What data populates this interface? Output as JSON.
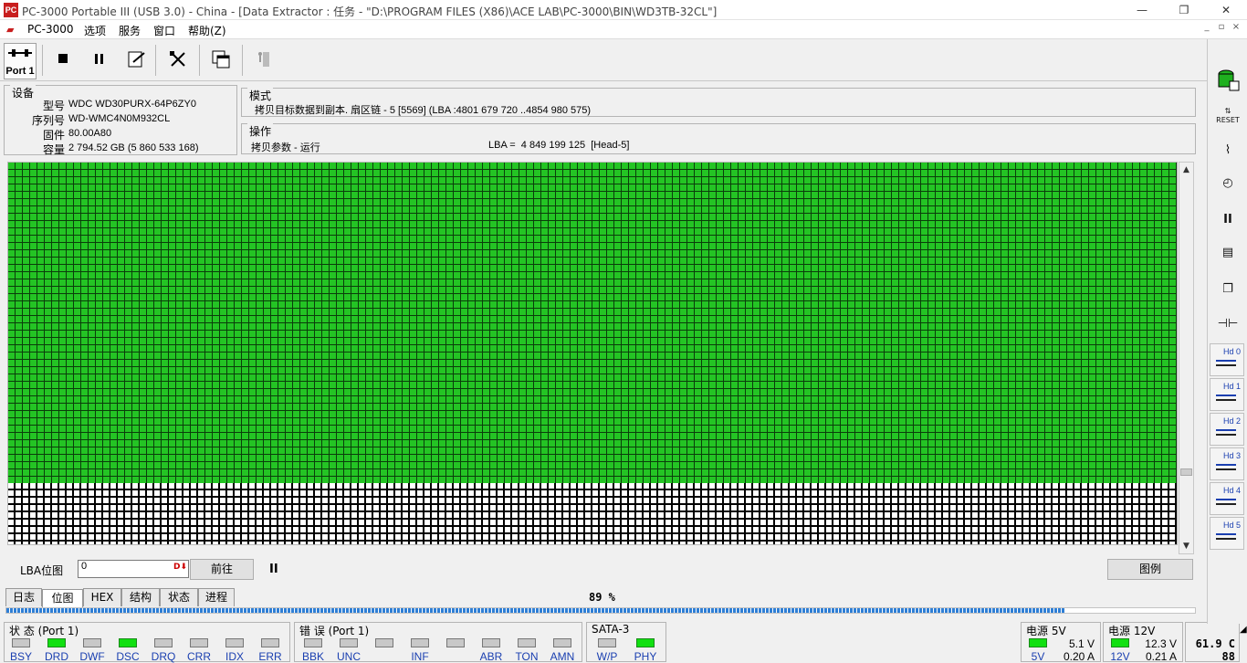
{
  "window": {
    "title": "PC-3000 Portable III (USB 3.0) - China - [Data Extractor : 任务 - \"D:\\PROGRAM FILES (X86)\\ACE LAB\\PC-3000\\BIN\\WD3TB-32CL\"]",
    "app_icon_text": "PC",
    "minimize": "—",
    "maximize": "❐",
    "close": "✕"
  },
  "menu": {
    "logo_label": "PC-3000",
    "items": [
      "选项",
      "服务",
      "窗口",
      "帮助(Z)"
    ],
    "mdi_minimize": "_",
    "mdi_restore": "▫",
    "mdi_close": "×"
  },
  "toolbar": {
    "port_label": "Port 1",
    "icons": [
      "stop-icon",
      "pause-icon",
      "edit-document-icon",
      "tools-icon",
      "copy-windows-icon",
      "exit-icon"
    ]
  },
  "device": {
    "title": "设备",
    "labels": {
      "model": "型号",
      "serial": "序列号",
      "firmware": "固件",
      "capacity": "容量"
    },
    "model": "WDC WD30PURX-64P6ZY0",
    "serial": "WD-WMC4N0M932CL",
    "firmware": "80.00A80",
    "capacity": "2 794.52 GB (5 860 533 168)"
  },
  "mode": {
    "title": "模式",
    "text": "拷贝目标数据到副本. 扇区链 - 5 [5569] (LBA :4801 679 720 ..4854 980 575)"
  },
  "operation": {
    "title": "操作",
    "text": "拷贝参数 - 运行",
    "lba_text": "LBA =  4 849 199 125  [Head-5]"
  },
  "bitmap": {
    "filled_fraction": 0.84
  },
  "lba_bar": {
    "label": "LBA位图",
    "input_value": "0",
    "goto_button": "前往",
    "pause_glyph": "II",
    "legend_button": "图例"
  },
  "tabs": [
    "日志",
    "位图",
    "HEX",
    "结构",
    "状态",
    "进程"
  ],
  "active_tab": 1,
  "progress": {
    "text": "89 %",
    "value": 0.89
  },
  "status": {
    "title": "状 态 (Port 1)",
    "leds": [
      {
        "name": "BSY",
        "on": false
      },
      {
        "name": "DRD",
        "on": true
      },
      {
        "name": "DWF",
        "on": false
      },
      {
        "name": "DSC",
        "on": true
      },
      {
        "name": "DRQ",
        "on": false
      },
      {
        "name": "CRR",
        "on": false
      },
      {
        "name": "IDX",
        "on": false
      },
      {
        "name": "ERR",
        "on": false
      }
    ]
  },
  "errors": {
    "title": "错 误 (Port 1)",
    "leds": [
      {
        "name": "BBK",
        "on": false
      },
      {
        "name": "UNC",
        "on": false
      },
      {
        "name": "",
        "on": false
      },
      {
        "name": "INF",
        "on": false
      },
      {
        "name": "",
        "on": false
      },
      {
        "name": "ABR",
        "on": false
      },
      {
        "name": "TON",
        "on": false
      },
      {
        "name": "AMN",
        "on": false
      }
    ]
  },
  "sata": {
    "title": "SATA-3",
    "leds": [
      {
        "name": "W/P",
        "on": false
      },
      {
        "name": "PHY",
        "on": true
      }
    ]
  },
  "power5": {
    "title": "电源 5V",
    "led_label": "5V",
    "voltage": "5.1 V",
    "current": "0.20 A"
  },
  "power12": {
    "title": "电源 12V",
    "led_label": "12V",
    "voltage": "12.3 V",
    "current": "0.21 A"
  },
  "temp": {
    "value": "61.9 C",
    "sub": "88"
  },
  "right_panel": {
    "reset_label": "RESET",
    "hd_buttons": [
      "Hd 0",
      "Hd 1",
      "Hd 2",
      "Hd 3",
      "Hd 4",
      "Hd 5"
    ]
  }
}
